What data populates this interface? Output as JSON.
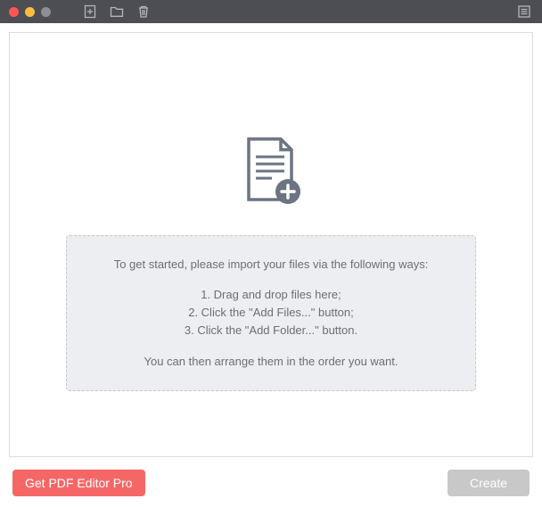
{
  "toolbar": {
    "icons": [
      "add-file",
      "folder",
      "trash"
    ],
    "right_icon": "list"
  },
  "instructions": {
    "intro": "To get started, please import your files via the following ways:",
    "steps": [
      "1. Drag and drop files here;",
      "2. Click the \"Add Files...\" button;",
      "3. Click the \"Add Folder...\" button."
    ],
    "footer": "You can then arrange them in the order you want."
  },
  "buttons": {
    "get_pro": "Get PDF Editor Pro",
    "create": "Create"
  }
}
